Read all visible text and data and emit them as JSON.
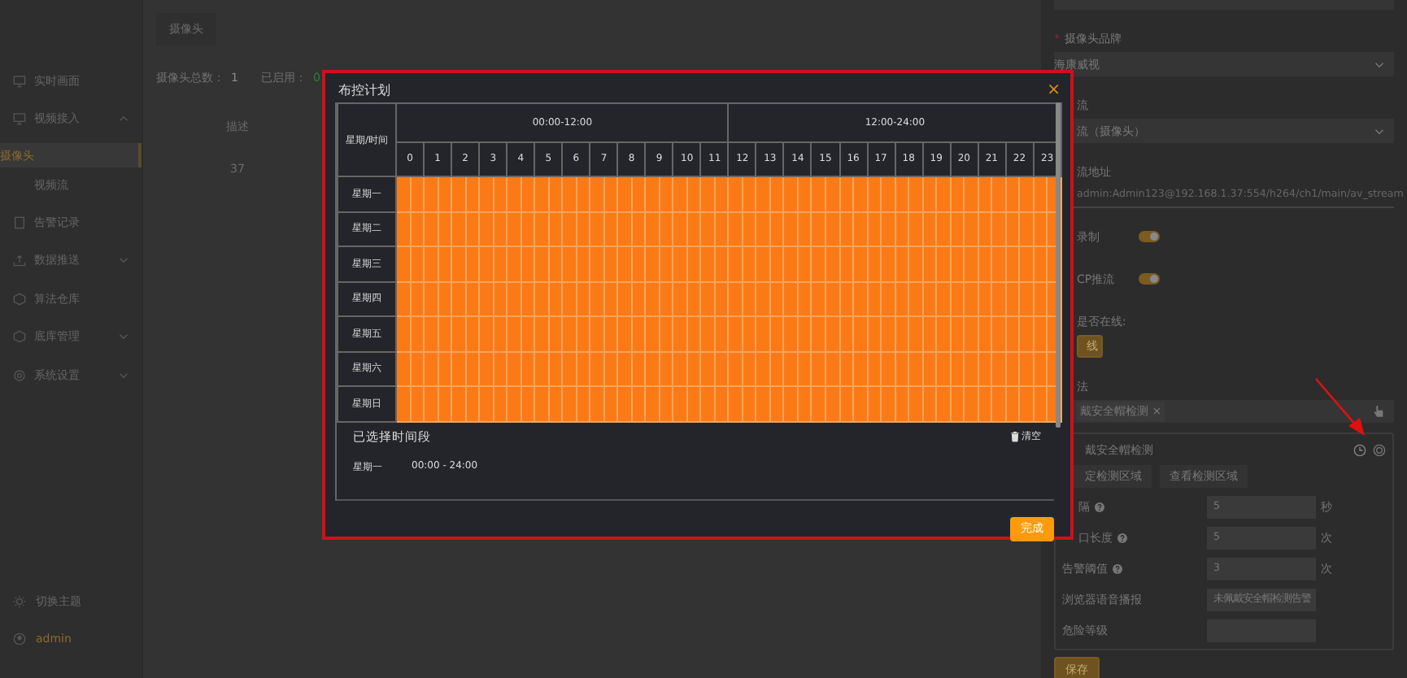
{
  "sidebar": {
    "items": [
      {
        "label": "实时画面",
        "selected": false
      },
      {
        "label": "视频接入",
        "selected": false,
        "expanded": true,
        "children": [
          {
            "label": "摄像头",
            "selected": true
          },
          {
            "label": "视频流",
            "selected": false
          }
        ]
      },
      {
        "label": "告警记录",
        "selected": false
      },
      {
        "label": "数据推送",
        "selected": false,
        "expanded": false
      },
      {
        "label": "算法仓库",
        "selected": false
      },
      {
        "label": "底库管理",
        "selected": false,
        "expanded": false
      },
      {
        "label": "系统设置",
        "selected": false,
        "expanded": false
      }
    ],
    "bottom": [
      {
        "label": "切换主题",
        "kind": "theme"
      },
      {
        "label": "admin",
        "kind": "user"
      }
    ]
  },
  "main": {
    "tab": "摄像头",
    "stats": [
      {
        "label": "摄像头总数：",
        "value": "1",
        "color": "#8a8a8a"
      },
      {
        "label": "已启用：",
        "value": "0",
        "color": "#2e7d32"
      }
    ],
    "column": "描述",
    "cell": "37"
  },
  "panel": {
    "fields": [
      {
        "kind": "select",
        "label": "摄像头品牌",
        "mark": "*",
        "value": "海康威视"
      },
      {
        "kind": "select",
        "label": "流",
        "value": "流（摄像头）"
      },
      {
        "kind": "input",
        "label": "流地址",
        "value": "admin:Admin123@192.168.1.37:554/h264/ch1/main/av_stream"
      },
      {
        "kind": "toggle",
        "label": "录制",
        "on": true
      },
      {
        "kind": "toggle",
        "label": "CP推流",
        "on": true
      },
      {
        "kind": "button",
        "label": "是否在线:",
        "value": "线"
      },
      {
        "kind": "tags",
        "label": "法",
        "tags": [
          {
            "label": "戴安全帽检测",
            "remove": "×"
          }
        ]
      }
    ],
    "card": {
      "title": "戴安全帽检测",
      "buttons": [
        "定检测区域",
        "查看检测区域"
      ],
      "rows": [
        {
          "label": "隔",
          "help": true,
          "value": "5",
          "unit": "秒"
        },
        {
          "label": "口长度",
          "help": true,
          "value": "5",
          "unit": "次"
        },
        {
          "label": "告警阈值",
          "help": true,
          "value": "3",
          "unit": "次"
        },
        {
          "label": "浏览器语音播报",
          "help": false,
          "value": "未佩戴安全帽检测告警"
        },
        {
          "label": "危险等级",
          "help": false,
          "value": ""
        }
      ]
    },
    "save": "保存"
  },
  "dialog": {
    "title": "布控计划",
    "close": "×",
    "corner": "星期/时间",
    "halves": [
      "00:00-12:00",
      "12:00-24:00"
    ],
    "hours": [
      "0",
      "1",
      "2",
      "3",
      "4",
      "5",
      "6",
      "7",
      "8",
      "9",
      "10",
      "11",
      "12",
      "13",
      "14",
      "15",
      "16",
      "17",
      "18",
      "19",
      "20",
      "21",
      "22",
      "23"
    ],
    "days": [
      {
        "name": "星期一",
        "slots": [
          true,
          true,
          true,
          true,
          true,
          true,
          true,
          true,
          true,
          true,
          true,
          true,
          true,
          true,
          true,
          true,
          true,
          true,
          true,
          true,
          true,
          true,
          true,
          true,
          true,
          true,
          true,
          true,
          true,
          true,
          true,
          true,
          true,
          true,
          true,
          true,
          true,
          true,
          true,
          true,
          true,
          true,
          true,
          true,
          true,
          true,
          true,
          true
        ]
      },
      {
        "name": "星期二",
        "slots": [
          true,
          true,
          true,
          true,
          true,
          true,
          true,
          true,
          true,
          true,
          true,
          true,
          true,
          true,
          true,
          true,
          true,
          true,
          true,
          true,
          true,
          true,
          true,
          true,
          true,
          true,
          true,
          true,
          true,
          true,
          true,
          true,
          true,
          true,
          true,
          true,
          true,
          true,
          true,
          true,
          true,
          true,
          true,
          true,
          true,
          true,
          true,
          true
        ]
      },
      {
        "name": "星期三",
        "slots": [
          true,
          true,
          true,
          true,
          true,
          true,
          true,
          true,
          true,
          true,
          true,
          true,
          true,
          true,
          true,
          true,
          true,
          true,
          true,
          true,
          true,
          true,
          true,
          true,
          true,
          true,
          true,
          true,
          true,
          true,
          true,
          true,
          true,
          true,
          true,
          true,
          true,
          true,
          true,
          true,
          true,
          true,
          true,
          true,
          true,
          true,
          true,
          true
        ]
      },
      {
        "name": "星期四",
        "slots": [
          true,
          true,
          true,
          true,
          true,
          true,
          true,
          true,
          true,
          true,
          true,
          true,
          true,
          true,
          true,
          true,
          true,
          true,
          true,
          true,
          true,
          true,
          true,
          true,
          true,
          true,
          true,
          true,
          true,
          true,
          true,
          true,
          true,
          true,
          true,
          true,
          true,
          true,
          true,
          true,
          true,
          true,
          true,
          true,
          true,
          true,
          true,
          true
        ]
      },
      {
        "name": "星期五",
        "slots": [
          true,
          true,
          true,
          true,
          true,
          true,
          true,
          true,
          true,
          true,
          true,
          true,
          true,
          true,
          true,
          true,
          true,
          true,
          true,
          true,
          true,
          true,
          true,
          true,
          true,
          true,
          true,
          true,
          true,
          true,
          true,
          true,
          true,
          true,
          true,
          true,
          true,
          true,
          true,
          true,
          true,
          true,
          true,
          true,
          true,
          true,
          true,
          true
        ]
      },
      {
        "name": "星期六",
        "slots": [
          true,
          true,
          true,
          true,
          true,
          true,
          true,
          true,
          true,
          true,
          true,
          true,
          true,
          true,
          true,
          true,
          true,
          true,
          true,
          true,
          true,
          true,
          true,
          true,
          true,
          true,
          true,
          true,
          true,
          true,
          true,
          true,
          true,
          true,
          true,
          true,
          true,
          true,
          true,
          true,
          true,
          true,
          true,
          true,
          true,
          true,
          true,
          true
        ]
      },
      {
        "name": "星期日",
        "slots": [
          true,
          true,
          true,
          true,
          true,
          true,
          true,
          true,
          true,
          true,
          true,
          true,
          true,
          true,
          true,
          true,
          true,
          true,
          true,
          true,
          true,
          true,
          true,
          true,
          true,
          true,
          true,
          true,
          true,
          true,
          true,
          true,
          true,
          true,
          true,
          true,
          true,
          true,
          true,
          true,
          true,
          true,
          true,
          true,
          true,
          true,
          true,
          true
        ]
      }
    ],
    "selected_title": "已选择时间段",
    "clear": "清空",
    "selected": [
      {
        "day": "星期一",
        "range": "00:00 - 24:00"
      }
    ],
    "done": "完成"
  }
}
